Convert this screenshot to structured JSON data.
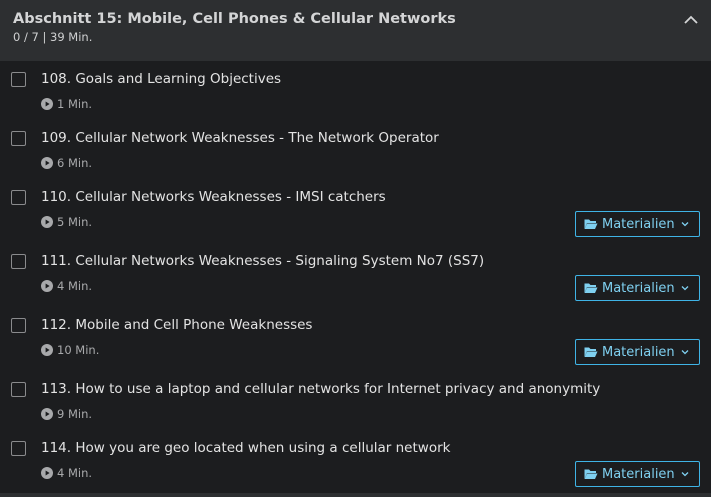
{
  "section": {
    "title": "Abschnitt 15: Mobile, Cell Phones & Cellular Networks",
    "meta": "0 / 7 | 39 Min."
  },
  "resources_label": "Materialien",
  "lectures": [
    {
      "title": "108. Goals and Learning Objectives",
      "duration": "1 Min."
    },
    {
      "title": "109. Cellular Network Weaknesses - The Network Operator",
      "duration": "6 Min."
    },
    {
      "title": "110. Cellular Networks Weaknesses - IMSI catchers",
      "duration": "5 Min."
    },
    {
      "title": "111. Cellular Networks Weaknesses - Signaling System No7 (SS7)",
      "duration": "4 Min."
    },
    {
      "title": "112. Mobile and Cell Phone Weaknesses",
      "duration": "10 Min."
    },
    {
      "title": "113. How to use a laptop and cellular networks for Internet privacy and anonymity",
      "duration": "9 Min."
    },
    {
      "title": "114. How you are geo located when using a cellular network",
      "duration": "4 Min."
    }
  ],
  "colors": {
    "accent": "#3fb4e6",
    "header_bg": "#2d2f31",
    "page_bg": "#1c1d1f"
  }
}
